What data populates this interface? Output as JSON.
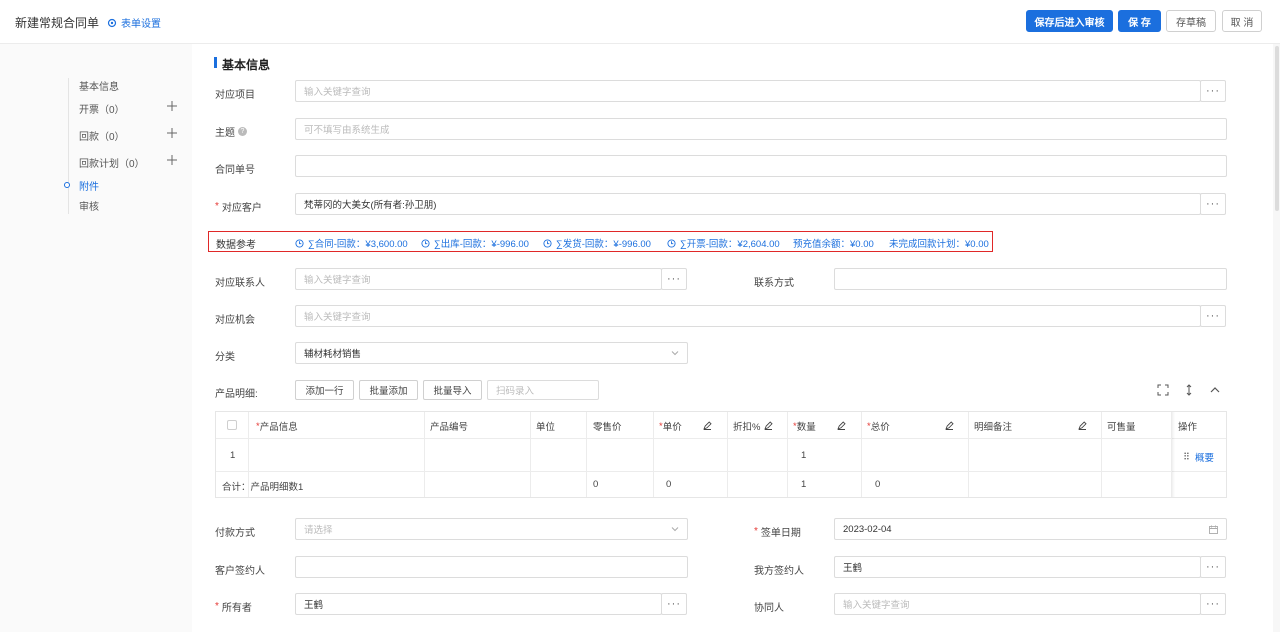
{
  "header": {
    "title": "新建常规合同单",
    "form_settings": "表单设置",
    "save_and_review": "保存后进入审核",
    "save": "保 存",
    "save_draft": "存草稿",
    "cancel": "取 消"
  },
  "sidebar": {
    "items": [
      {
        "label": "基本信息"
      },
      {
        "label": "开票（0）"
      },
      {
        "label": "回款（0）"
      },
      {
        "label": "回款计划（0）"
      },
      {
        "label": "附件"
      },
      {
        "label": "审核"
      }
    ]
  },
  "form": {
    "section_title": "基本信息",
    "project": {
      "label": "对应项目",
      "placeholder": "输入关键字查询"
    },
    "subject": {
      "label": "主题",
      "placeholder": "可不填写由系统生成"
    },
    "contract_no": {
      "label": "合同单号",
      "value": ""
    },
    "customer": {
      "label": "对应客户",
      "value": "梵蒂冈的大美女(所有者:孙卫朋)"
    },
    "data_ref": {
      "label": "数据参考",
      "items": [
        "∑合同-回款：¥3,600.00",
        "∑出库-回款：¥-996.00",
        "∑发货-回款：¥-996.00",
        "∑开票-回款：¥2,604.00",
        "预充值余额：¥0.00",
        "未完成回款计划：¥0.00"
      ]
    },
    "contact": {
      "label": "对应联系人",
      "placeholder": "输入关键字查询"
    },
    "contact_method": {
      "label": "联系方式",
      "value": ""
    },
    "opportunity": {
      "label": "对应机会",
      "placeholder": "输入关键字查询"
    },
    "category": {
      "label": "分类",
      "value": "辅材耗材销售"
    },
    "products": {
      "label": "产品明细:",
      "add_row": "添加一行",
      "batch_add": "批量添加",
      "batch_import": "批量导入",
      "scan_placeholder": "扫码录入"
    },
    "payment_method": {
      "label": "付款方式",
      "placeholder": "请选择"
    },
    "sign_date": {
      "label": "签单日期",
      "value": "2023-02-04"
    },
    "customer_signer": {
      "label": "客户签约人",
      "value": ""
    },
    "our_signer": {
      "label": "我方签约人",
      "value": "王鹤"
    },
    "owner": {
      "label": "所有者",
      "value": "王鹤"
    },
    "collaborator": {
      "label": "协同人",
      "placeholder": "输入关键字查询"
    }
  },
  "table": {
    "headers": [
      "产品信息",
      "产品编号",
      "单位",
      "零售价",
      "单价",
      "折扣%",
      "数量",
      "总价",
      "明细备注",
      "可售量",
      "操作"
    ],
    "row": {
      "index": "1",
      "quantity": "1",
      "action": "概要"
    },
    "total": {
      "label": "合计：产品明细数1",
      "retail": "0",
      "unit_price": "0",
      "quantity": "1",
      "total": "0"
    }
  },
  "colors": {
    "primary": "#1b6fde",
    "required": "#e53935",
    "highlight_border": "#e02828"
  }
}
